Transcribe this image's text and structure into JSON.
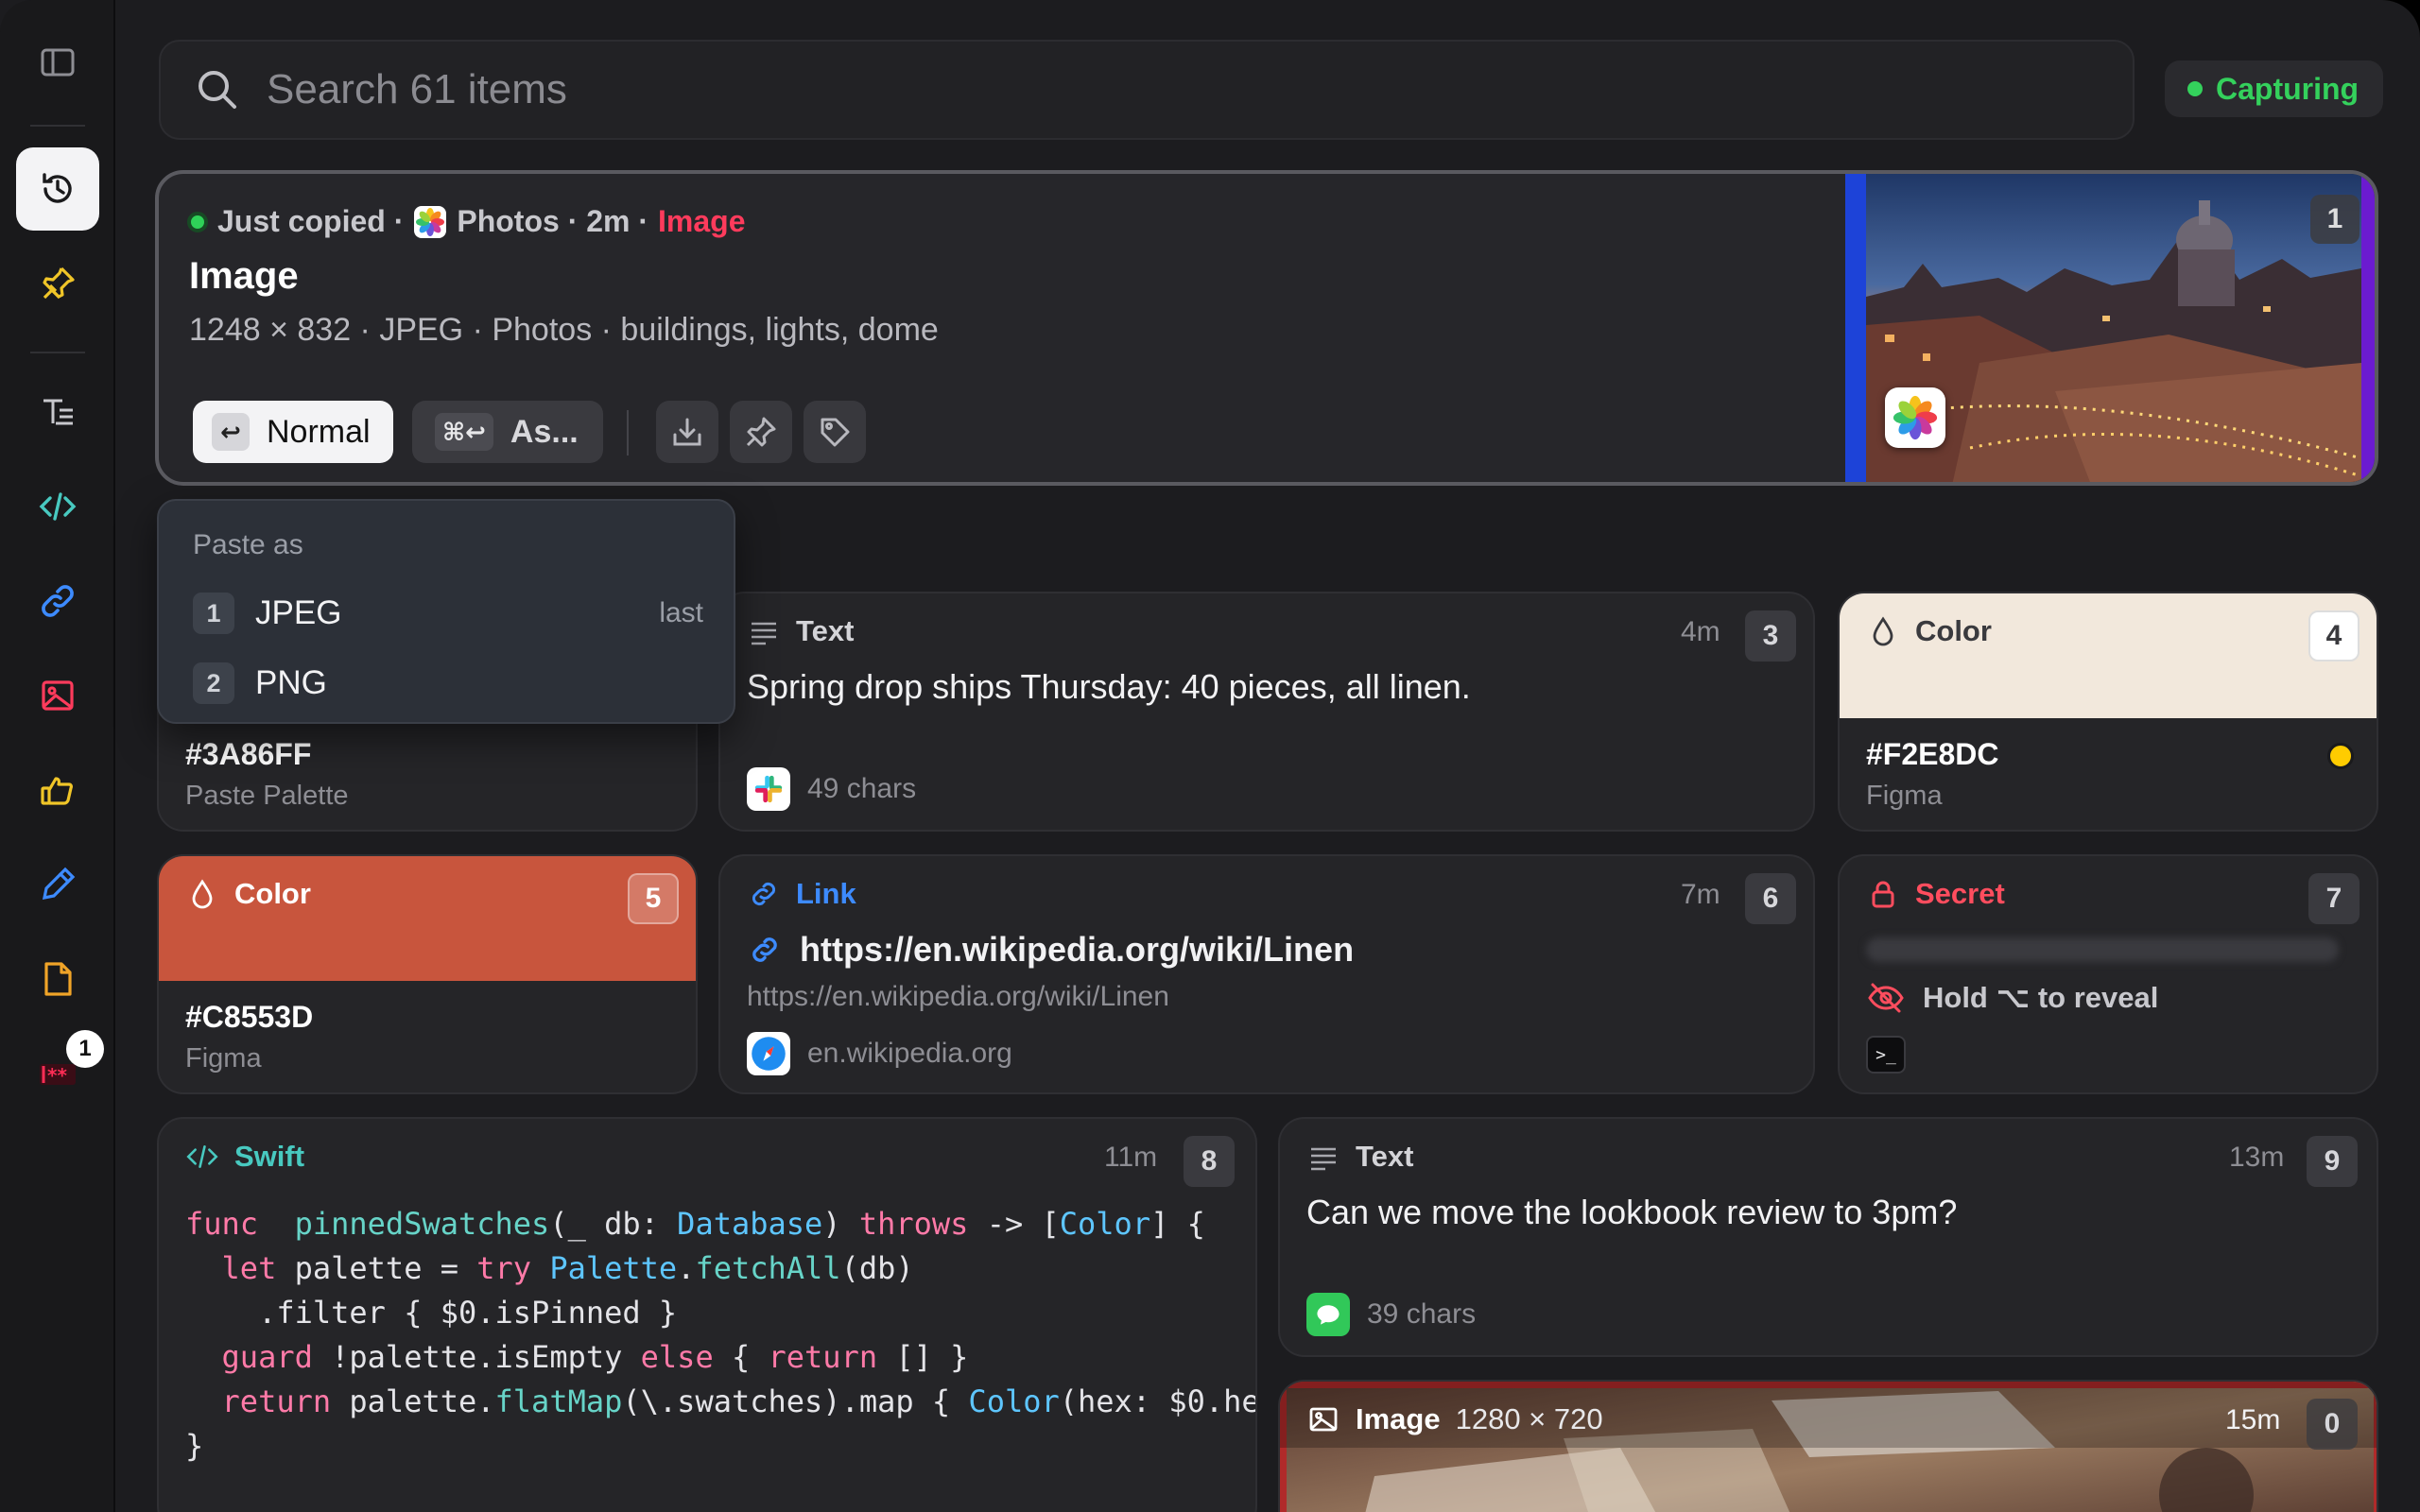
{
  "sidebar": {
    "badge_count": "1"
  },
  "search": {
    "placeholder": "Search 61 items"
  },
  "status": {
    "label": "Capturing",
    "color": "#34d15c"
  },
  "hero": {
    "meta_prefix": "Just copied ·",
    "meta_app": "Photos · 2m ·",
    "meta_type": "Image",
    "title": "Image",
    "description": "1248 × 832 · JPEG · Photos · buildings, lights, dome",
    "paste_label": "Normal",
    "paste_key": "↩",
    "as_key": "⌘↩",
    "as_label": "As...",
    "number": "1"
  },
  "paste_menu": {
    "title": "Paste as",
    "items": [
      {
        "key": "1",
        "label": "JPEG",
        "note": "last"
      },
      {
        "key": "2",
        "label": "PNG",
        "note": ""
      }
    ]
  },
  "cards": {
    "palette": {
      "hex": "#3A86FF",
      "source": "Paste Palette"
    },
    "text1": {
      "type": "Text",
      "time": "4m",
      "number": "3",
      "body": "Spring drop ships Thursday: 40 pieces, all linen.",
      "meta": "49 chars"
    },
    "color4": {
      "type": "Color",
      "number": "4",
      "hex": "#F2E8DC",
      "source": "Figma",
      "swatch": "#f2e8dc"
    },
    "color5": {
      "type": "Color",
      "number": "5",
      "hex": "#C8553D",
      "source": "Figma",
      "swatch": "#c8553d"
    },
    "link": {
      "type": "Link",
      "time": "7m",
      "number": "6",
      "title": "https://en.wikipedia.org/wiki/Linen",
      "url": "https://en.wikipedia.org/wiki/Linen",
      "domain": "en.wikipedia.org"
    },
    "secret": {
      "type": "Secret",
      "number": "7",
      "hint": "Hold ⌥ to reveal"
    },
    "swift": {
      "type": "Swift",
      "time": "11m",
      "number": "8"
    },
    "text2": {
      "type": "Text",
      "time": "13m",
      "number": "9",
      "body": "Can we move the lookbook review to 3pm?",
      "meta": "39 chars"
    },
    "image2": {
      "type": "Image",
      "size": "1280 × 720",
      "time": "15m",
      "number": "0"
    }
  },
  "code_lines": [
    [
      [
        "k",
        "func"
      ],
      [
        "",
        "  "
      ],
      [
        "f",
        "pinnedSwatches"
      ],
      [
        "",
        "(_ db: "
      ],
      [
        "t",
        "Database"
      ],
      [
        "",
        ") "
      ],
      [
        "k",
        "throws"
      ],
      [
        "",
        " -> ["
      ],
      [
        "t",
        "Color"
      ],
      [
        "",
        "] {"
      ]
    ],
    [
      [
        "",
        "  "
      ],
      [
        "k",
        "let"
      ],
      [
        "",
        " palette = "
      ],
      [
        "k",
        "try"
      ],
      [
        "",
        " "
      ],
      [
        "t",
        "Palette"
      ],
      [
        "",
        "."
      ],
      [
        "f",
        "fetchAll"
      ],
      [
        "",
        "(db)"
      ]
    ],
    [
      [
        "",
        "    .filter { $0.isPinned }"
      ]
    ],
    [
      [
        "",
        "  "
      ],
      [
        "k",
        "guard"
      ],
      [
        "",
        " !palette.isEmpty "
      ],
      [
        "k",
        "else"
      ],
      [
        "",
        " { "
      ],
      [
        "k",
        "return"
      ],
      [
        "",
        " [] }"
      ]
    ],
    [
      [
        "",
        "  "
      ],
      [
        "k",
        "return"
      ],
      [
        "",
        " palette."
      ],
      [
        "f",
        "flatMap"
      ],
      [
        "",
        "(\\.swatches).map { "
      ],
      [
        "t",
        "Color"
      ],
      [
        "",
        "(hex: $0.he"
      ]
    ],
    [
      [
        "",
        "}"
      ]
    ]
  ],
  "icons": [
    "sidebar-toggle-icon",
    "history-icon",
    "pin-icon",
    "text-icon",
    "code-icon",
    "link-icon",
    "image-icon",
    "thumbs-up-icon",
    "eyedropper-icon",
    "file-icon",
    "password-icon",
    "search-icon",
    "download-icon",
    "tag-icon",
    "lock-icon",
    "eye-slash-icon",
    "droplet-icon",
    "photos-icon",
    "slack-icon",
    "safari-icon",
    "terminal-icon",
    "messages-icon"
  ]
}
